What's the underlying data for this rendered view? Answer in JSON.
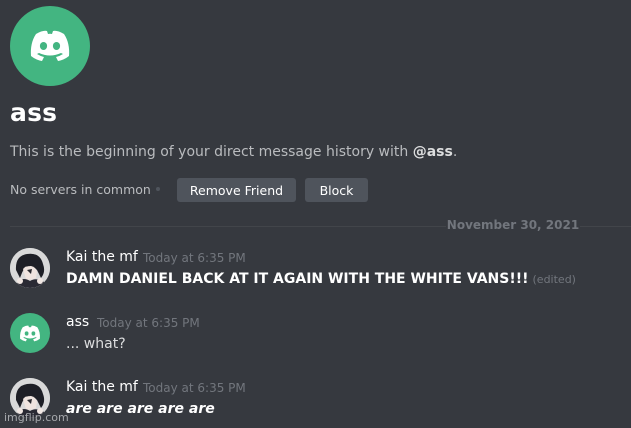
{
  "conversation": {
    "title": "ass",
    "intro_prefix": "This is the beginning of your direct message history with ",
    "intro_handle": "@ass",
    "intro_suffix": ".",
    "servers_text": "No servers in common",
    "remove_friend_label": "Remove Friend",
    "block_label": "Block",
    "date_divider": "November 30, 2021",
    "avatar_icon": "discord-logo-icon"
  },
  "messages": [
    {
      "author": "Kai the mf",
      "timestamp": "Today at 6:35 PM",
      "text": "DAMN DANIEL BACK AT IT AGAIN WITH THE WHITE VANS!!!",
      "edited": "(edited)"
    },
    {
      "author": "ass",
      "timestamp": "Today at 6:35 PM",
      "text": "... what?"
    },
    {
      "author": "Kai the mf",
      "timestamp": "Today at 6:35 PM",
      "text": "are are are are are"
    }
  ],
  "watermark": "imgflip.com",
  "colors": {
    "background": "#36393f",
    "avatar_green": "#43b581",
    "button_gray": "#4f545c",
    "muted_text": "#72767d"
  }
}
